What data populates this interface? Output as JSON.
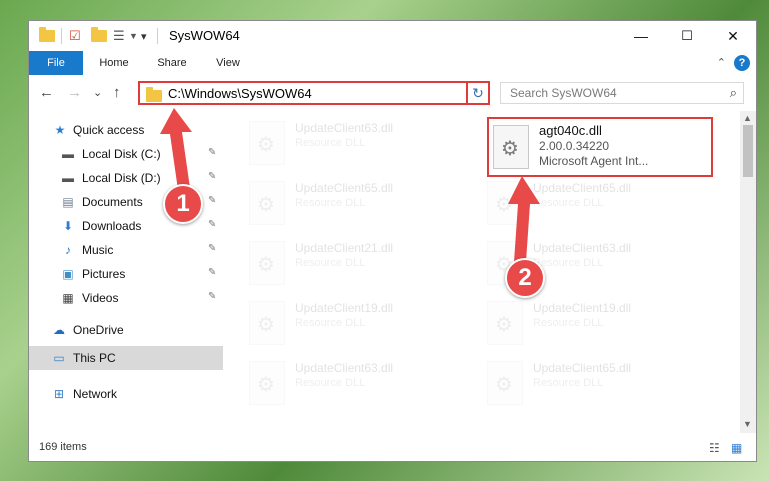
{
  "window": {
    "title": "SysWOW64",
    "controls": {
      "minimize": "—",
      "maximize": "☐",
      "close": "✕"
    }
  },
  "ribbon": {
    "tabs": [
      "File",
      "Home",
      "Share",
      "View"
    ],
    "help": "?",
    "collapse": "⌃"
  },
  "navigation": {
    "back": "←",
    "forward": "→",
    "recent": "⌄",
    "up": "↑",
    "address": "C:\\Windows\\SysWOW64",
    "address_dropdown": "⌄",
    "refresh": "↻",
    "search_placeholder": "Search SysWOW64",
    "search_icon": "⌕"
  },
  "sidebar": {
    "items": [
      {
        "label": "Quick access",
        "icon": "★",
        "icon_name": "star-icon",
        "color": "#2f7dd3",
        "pinned": false,
        "selected": false
      },
      {
        "label": "Local Disk (C:)",
        "icon": "▬",
        "icon_name": "drive-icon",
        "color": "#555555",
        "pinned": true,
        "selected": false
      },
      {
        "label": "Local Disk (D:)",
        "icon": "▬",
        "icon_name": "drive-icon",
        "color": "#555555",
        "pinned": true,
        "selected": false
      },
      {
        "label": "Documents",
        "icon": "▤",
        "icon_name": "documents-icon",
        "color": "#6b7c8f",
        "pinned": true,
        "selected": false
      },
      {
        "label": "Downloads",
        "icon": "⬇",
        "icon_name": "downloads-icon",
        "color": "#2f7dd3",
        "pinned": true,
        "selected": false
      },
      {
        "label": "Music",
        "icon": "♪",
        "icon_name": "music-icon",
        "color": "#2f7dd3",
        "pinned": true,
        "selected": false
      },
      {
        "label": "Pictures",
        "icon": "▣",
        "icon_name": "pictures-icon",
        "color": "#3d8fc9",
        "pinned": true,
        "selected": false
      },
      {
        "label": "Videos",
        "icon": "▦",
        "icon_name": "videos-icon",
        "color": "#444444",
        "pinned": true,
        "selected": false
      },
      {
        "label": "OneDrive",
        "icon": "☁",
        "icon_name": "cloud-icon",
        "color": "#1e6fc4",
        "pinned": false,
        "selected": false
      },
      {
        "label": "This PC",
        "icon": "▭",
        "icon_name": "computer-icon",
        "color": "#3b83c8",
        "pinned": false,
        "selected": true
      },
      {
        "label": "Network",
        "icon": "⊞",
        "icon_name": "network-icon",
        "color": "#3b83c8",
        "pinned": false,
        "selected": false
      }
    ],
    "pin_glyph": "✎"
  },
  "files": {
    "left_column": [
      {
        "name": "UpdateClient63.dll",
        "type": "Resource DLL"
      },
      {
        "name": "UpdateClient65.dll",
        "type": "Resource DLL"
      },
      {
        "name": "UpdateClient21.dll",
        "type": "Resource DLL"
      },
      {
        "name": "UpdateClient19.dll",
        "type": "Resource DLL"
      },
      {
        "name": "UpdateClient63.dll",
        "type": "Resource DLL"
      }
    ],
    "right_column": [
      {
        "name": "agt040c.dll",
        "version": "2.00.0.34220",
        "description": "Microsoft Agent Int...",
        "highlighted": true
      },
      {
        "name": "UpdateClient65.dll",
        "type": "Resource DLL"
      },
      {
        "name": "UpdateClient63.dll",
        "type": "Resource DLL"
      },
      {
        "name": "UpdateClient19.dll",
        "type": "Resource DLL"
      },
      {
        "name": "UpdateClient65.dll",
        "type": "Resource DLL"
      }
    ]
  },
  "status": {
    "item_count": "169 items",
    "details_view": "☷",
    "large_icons_view": "▦"
  },
  "annotations": {
    "step1": "1",
    "step2": "2",
    "color": "#e84a4a"
  }
}
